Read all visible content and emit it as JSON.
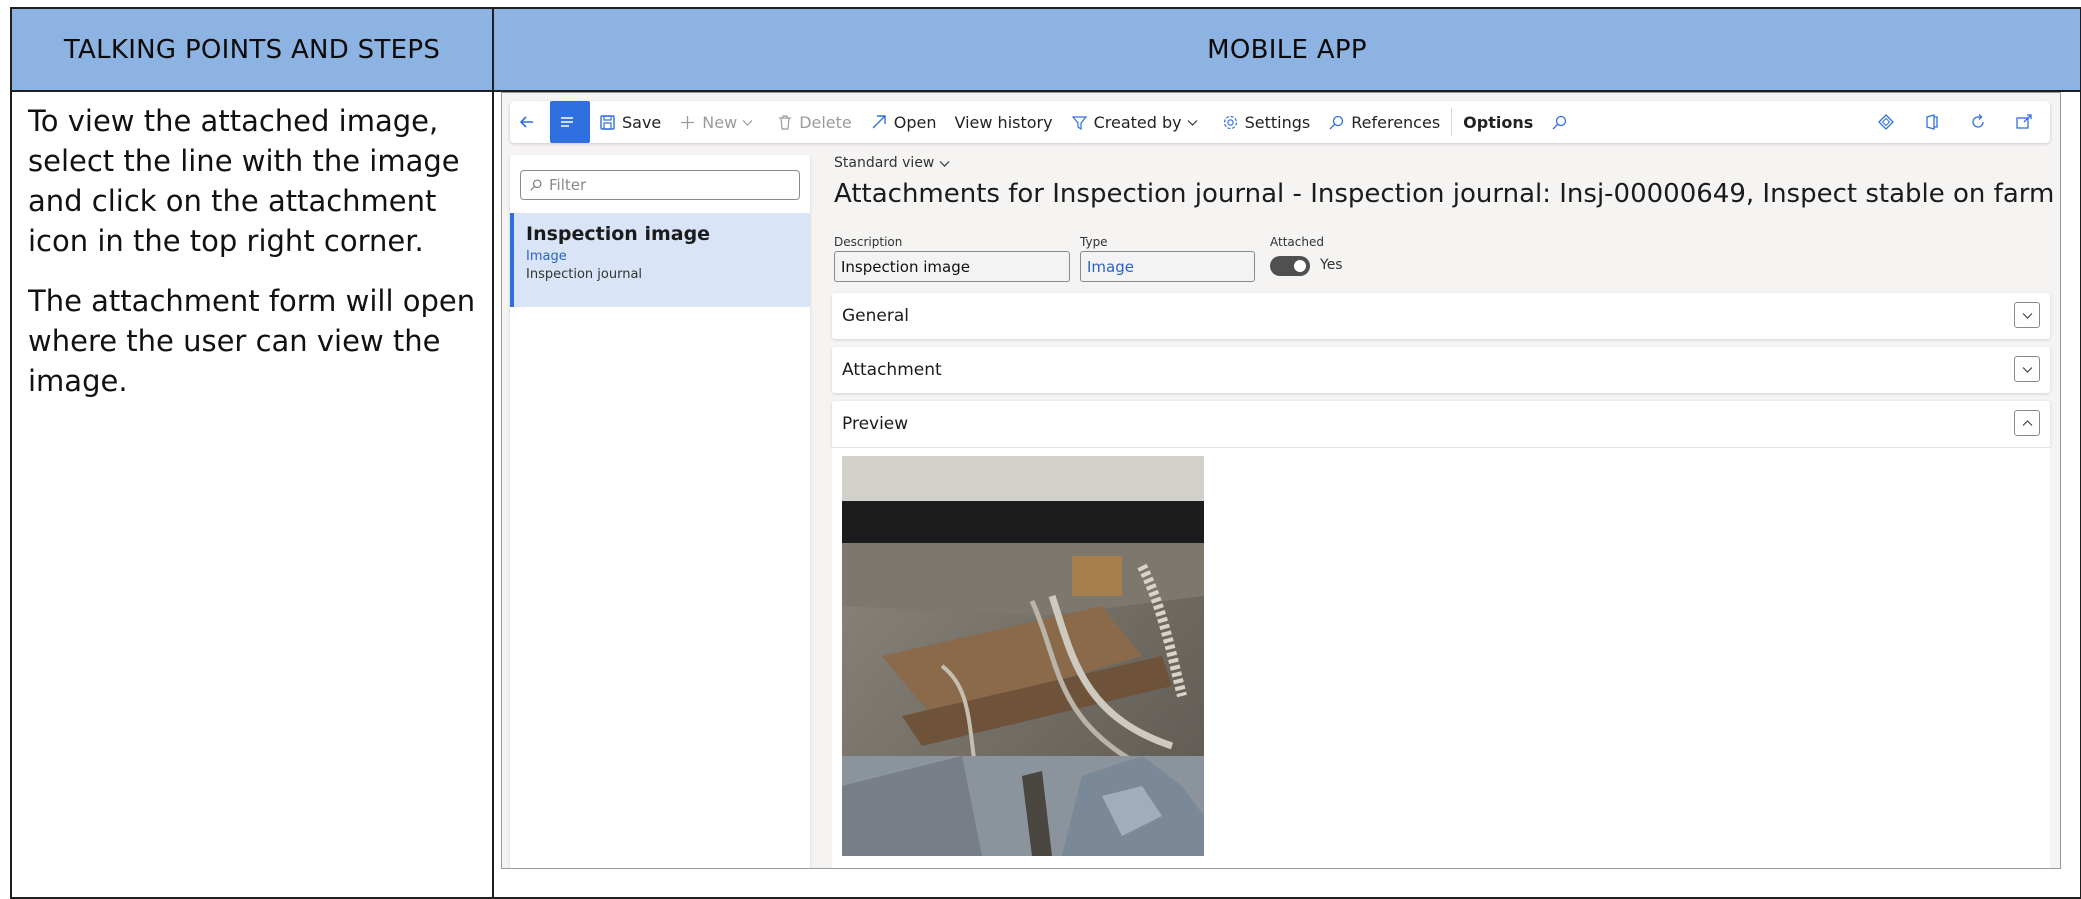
{
  "header": {
    "left": "TALKING POINTS AND STEPS",
    "right": "MOBILE APP"
  },
  "talking_points": [
    "To view the attached image, select the line with the image and click on the attachment icon in the top right corner.",
    "The attachment form will open where the user can view the image."
  ],
  "toolbar": {
    "save": "Save",
    "new": "New",
    "delete": "Delete",
    "open": "Open",
    "view_history": "View history",
    "created_by": "Created by",
    "settings": "Settings",
    "references": "References",
    "options": "Options"
  },
  "filter": {
    "placeholder": "Filter"
  },
  "list": {
    "selected": {
      "title": "Inspection image",
      "type": "Image",
      "source": "Inspection journal"
    }
  },
  "form": {
    "view": "Standard view",
    "title": "Attachments for Inspection journal - Inspection journal: Insj-00000649, Inspect stable on farm south",
    "fields": {
      "description_label": "Description",
      "description_value": "Inspection image",
      "type_label": "Type",
      "type_value": "Image",
      "attached_label": "Attached",
      "attached_value": "Yes"
    },
    "fasttabs": {
      "general": "General",
      "attachment": "Attachment",
      "preview": "Preview"
    }
  },
  "colors": {
    "header_bg": "#8db3e2",
    "accent": "#2f6fe0",
    "selected_row": "#d9e5f7"
  }
}
